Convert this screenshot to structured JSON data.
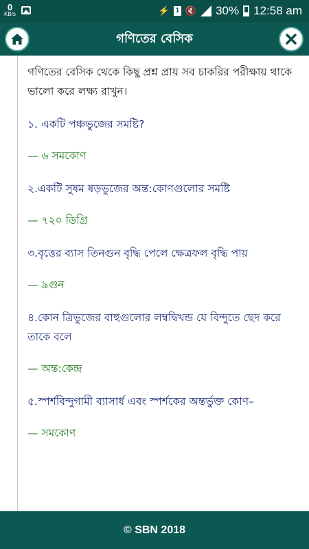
{
  "status_bar": {
    "kbs_value": "0",
    "kbs_unit": "KB/s",
    "battery": "30%",
    "time": "12:58 am",
    "sim_label": "1"
  },
  "header": {
    "title": "গণিতের বেসিক"
  },
  "content": {
    "intro": "গণিতের বেসিক থেকে কিছু প্রশ্ন প্রায় সব চাকরির পরীক্ষায় থাকে ভালো করে লক্ষ্য রাখুন।",
    "items": [
      {
        "q": "১. একটি পঞ্চভুজের সমষ্টি?",
        "a": "— ৬ সমকোণ"
      },
      {
        "q": "২.একটি সুষম ষড়ভুজের অন্ত:কোণগুলোর সমষ্টি",
        "a": "— ৭২০ ডিগ্রি"
      },
      {
        "q": "৩.বৃত্তের ব্যাস তিনগুন বৃদ্ধি পেলে ক্ষেত্রফল বৃদ্ধি পায়",
        "a": "— ৯গুন"
      },
      {
        "q": "৪.কোন ত্রিভুজের বাহুগুলোর লম্বদ্বিখন্ড যে বিন্দুতে ছেদ করে তাকে বলে",
        "a": "— অন্ত:কেন্দ্র"
      },
      {
        "q": "৫.স্পর্শবিন্দুগামী ব্যাসার্ধ এবং স্পর্শকের অন্তর্ভুক্ত কোণ–",
        "a": "— সমকোণ"
      }
    ]
  },
  "footer": {
    "text": "© SBN 2018"
  }
}
